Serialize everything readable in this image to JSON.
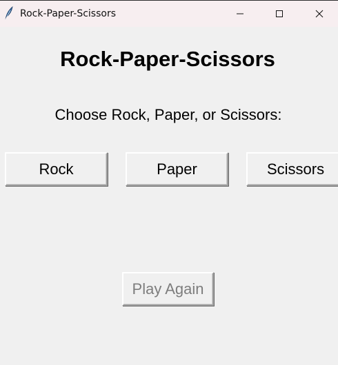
{
  "window": {
    "title": "Rock-Paper-Scissors",
    "icon": "feather-icon"
  },
  "main": {
    "heading": "Rock-Paper-Scissors",
    "prompt": "Choose Rock, Paper, or Scissors:",
    "choices": [
      "Rock",
      "Paper",
      "Scissors"
    ],
    "play_again_label": "Play Again",
    "play_again_disabled": true
  },
  "colors": {
    "background": "#f0f0f0",
    "titlebar": "#f7eef0",
    "disabled_text": "#7d7d7d"
  }
}
